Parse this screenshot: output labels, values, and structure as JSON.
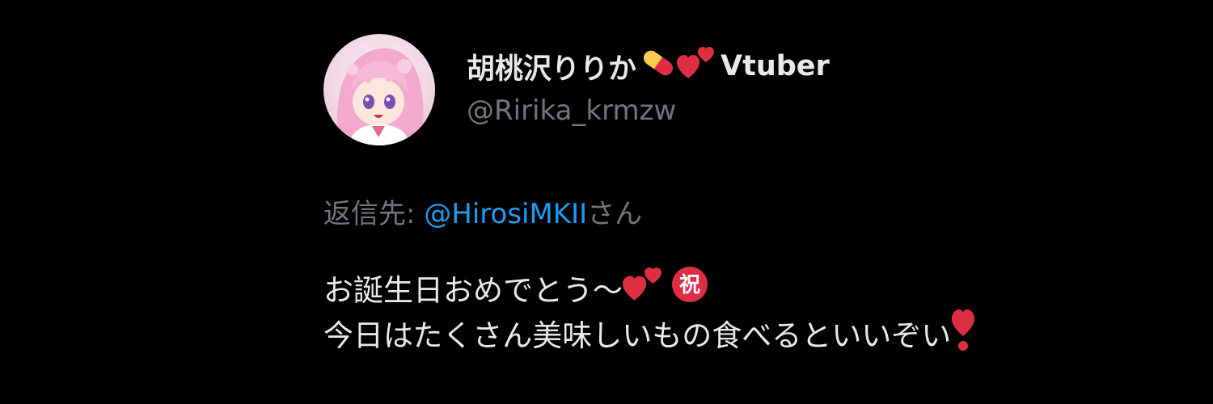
{
  "profile": {
    "display_name": "胡桃沢りりか",
    "name_icons": [
      "pill-icon",
      "two-hearts-icon"
    ],
    "display_suffix": "Vtuber",
    "handle": "@Ririka_krmzw"
  },
  "reply": {
    "prefix": "返信先: ",
    "mention": "@HirosiMKII",
    "suffix": "さん"
  },
  "tweet": {
    "line1": "お誕生日おめでとう～",
    "line1_icons": [
      "two-hearts-icon",
      "circled-iwai-icon"
    ],
    "line2": "今日はたくさん美味しいもの食べるといいぞい",
    "line2_icons": [
      "heavy-exclamation-heart-icon"
    ],
    "iwai_glyph": "祝"
  },
  "colors": {
    "background": "#000000",
    "text_primary": "#e7e9ea",
    "text_secondary": "#71767b",
    "link": "#1d9bf0",
    "heart": "#dd2e44",
    "pill_yellow": "#ffcc4d"
  }
}
